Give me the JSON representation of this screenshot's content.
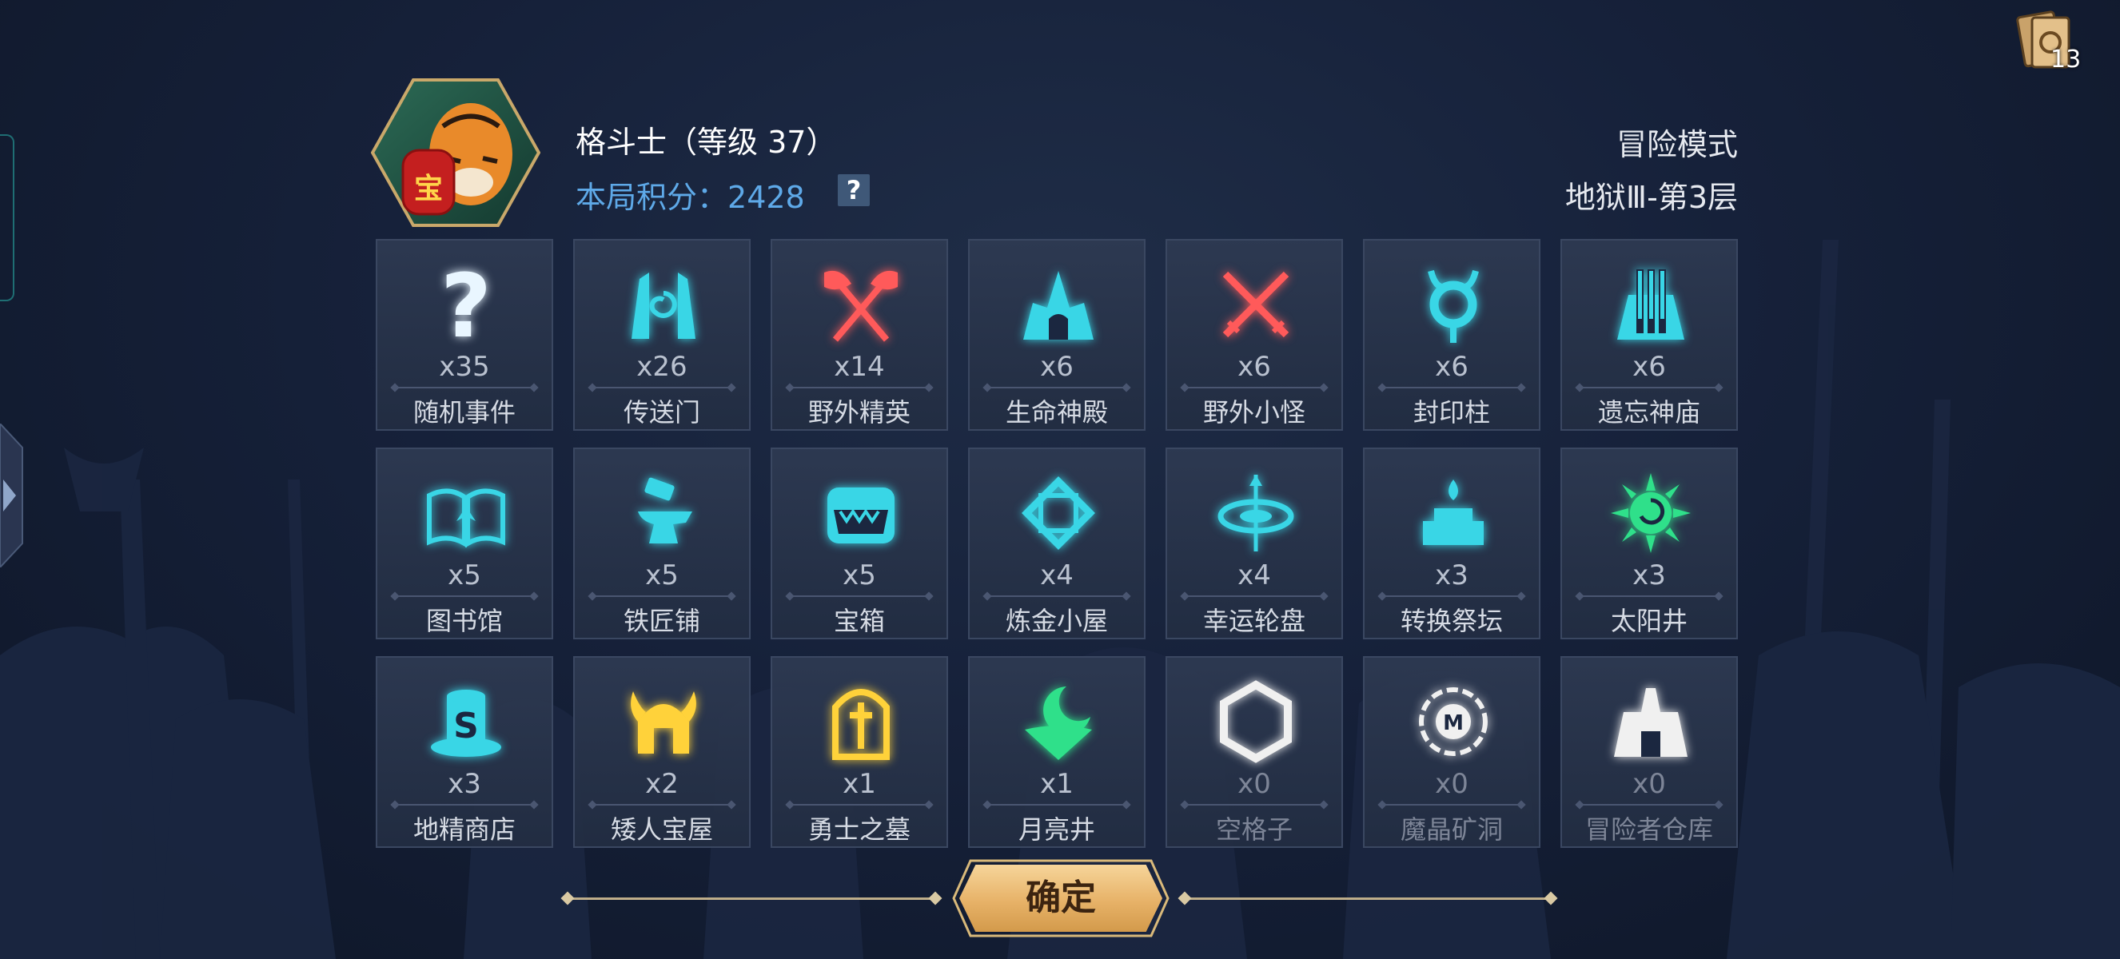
{
  "header": {
    "player_title": "格斗士（等级 37）",
    "score_label": "本局积分：",
    "score_value": "2428",
    "help_glyph": "?",
    "mode": "冒险模式",
    "level": "地狱Ⅲ-第3层"
  },
  "deck": {
    "count": "13",
    "icon": "card-deck-icon"
  },
  "avatar": {
    "badge_text": "宝",
    "icon": "tiger-portrait"
  },
  "tiles": [
    {
      "count": "x35",
      "name": "随机事件",
      "icon": "question-mark-icon",
      "color": "#e9f6ff"
    },
    {
      "count": "x26",
      "name": "传送门",
      "icon": "portal-icon",
      "color": "#39d6e6"
    },
    {
      "count": "x14",
      "name": "野外精英",
      "icon": "crossed-axes-icon",
      "color": "#ff5a5a"
    },
    {
      "count": "x6",
      "name": "生命神殿",
      "icon": "life-temple-icon",
      "color": "#39d6e6"
    },
    {
      "count": "x6",
      "name": "野外小怪",
      "icon": "crossed-swords-icon",
      "color": "#ff5a5a"
    },
    {
      "count": "x6",
      "name": "封印柱",
      "icon": "seal-pillar-icon",
      "color": "#39d6e6"
    },
    {
      "count": "x6",
      "name": "遗忘神庙",
      "icon": "forgotten-temple-icon",
      "color": "#39d6e6"
    },
    {
      "count": "x5",
      "name": "图书馆",
      "icon": "open-book-icon",
      "color": "#39d6e6"
    },
    {
      "count": "x5",
      "name": "铁匠铺",
      "icon": "anvil-icon",
      "color": "#39d6e6"
    },
    {
      "count": "x5",
      "name": "宝箱",
      "icon": "treasure-chest-icon",
      "color": "#39d6e6"
    },
    {
      "count": "x4",
      "name": "炼金小屋",
      "icon": "alchemy-diamond-icon",
      "color": "#39d6e6"
    },
    {
      "count": "x4",
      "name": "幸运轮盘",
      "icon": "lucky-wheel-icon",
      "color": "#39d6e6"
    },
    {
      "count": "x3",
      "name": "转换祭坛",
      "icon": "altar-icon",
      "color": "#39d6e6"
    },
    {
      "count": "x3",
      "name": "太阳井",
      "icon": "sun-well-icon",
      "color": "#2fe08a"
    },
    {
      "count": "x3",
      "name": "地精商店",
      "icon": "goblin-shop-icon",
      "color": "#39d6e6"
    },
    {
      "count": "x2",
      "name": "矮人宝屋",
      "icon": "dwarf-helmet-icon",
      "color": "#ffd23a"
    },
    {
      "count": "x1",
      "name": "勇士之墓",
      "icon": "tombstone-icon",
      "color": "#ffd23a"
    },
    {
      "count": "x1",
      "name": "月亮井",
      "icon": "moon-well-icon",
      "color": "#2fe08a"
    },
    {
      "count": "x0",
      "name": "空格子",
      "icon": "empty-hexagon-icon",
      "color": "#f0f0f0"
    },
    {
      "count": "x0",
      "name": "魔晶矿洞",
      "icon": "magic-crystal-mine-icon",
      "color": "#f0f0f0"
    },
    {
      "count": "x0",
      "name": "冒险者仓库",
      "icon": "adventurer-warehouse-icon",
      "color": "#f0f0f0"
    }
  ],
  "confirm": {
    "label": "确定"
  }
}
